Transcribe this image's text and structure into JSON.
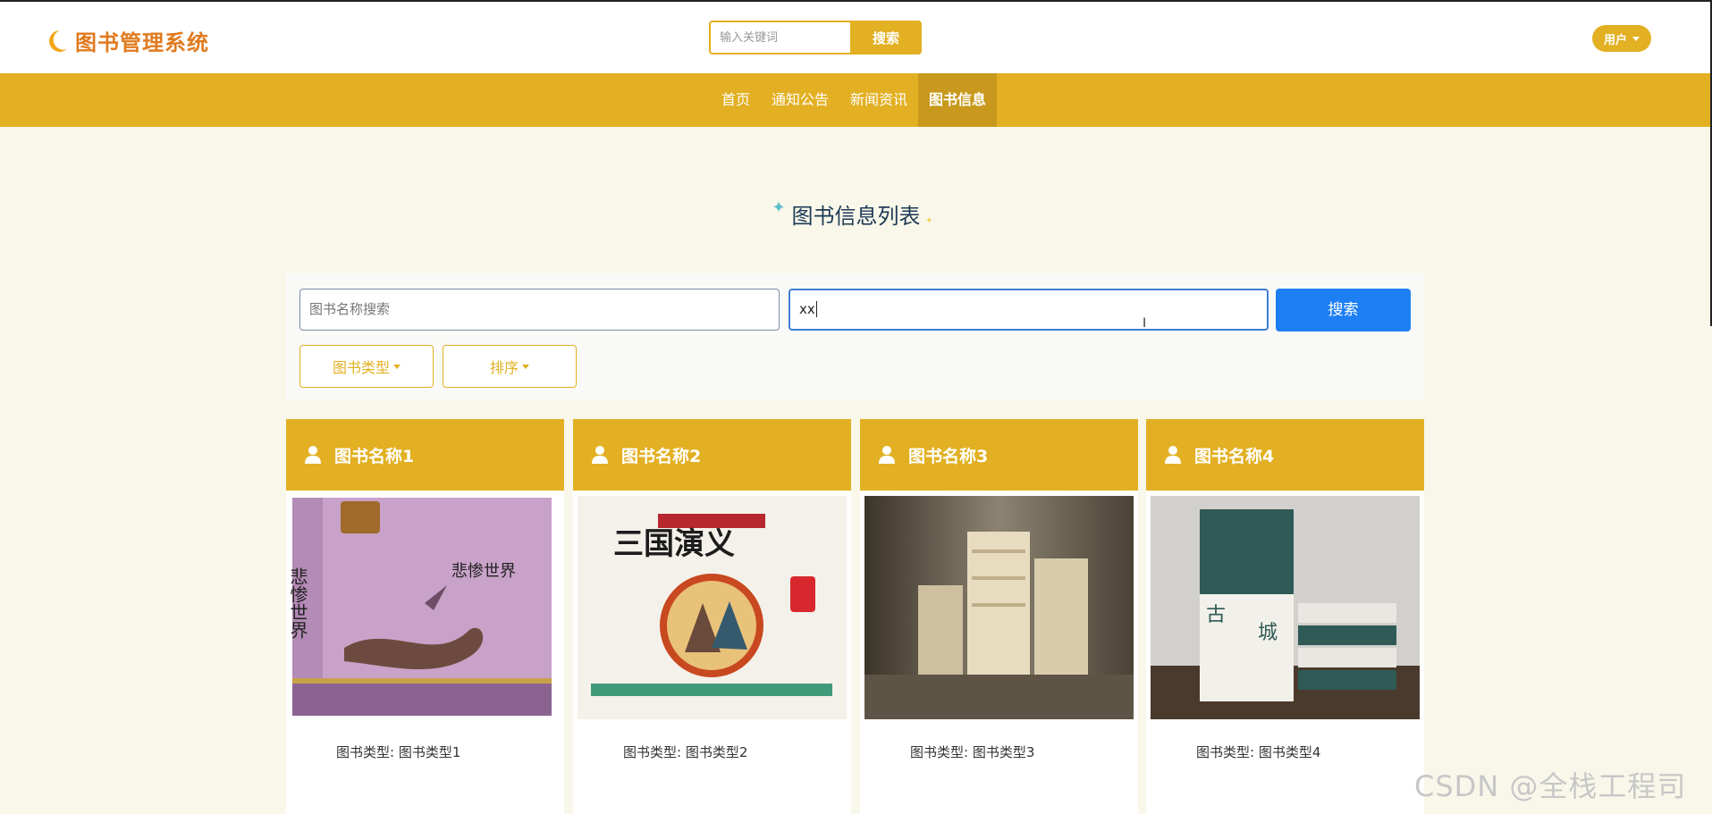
{
  "brand": {
    "title": "图书管理系统",
    "accent": "#e07a1f"
  },
  "top_search": {
    "placeholder": "输入关键词",
    "button": "搜索"
  },
  "user_menu": {
    "label": "用户"
  },
  "nav": {
    "items": [
      {
        "label": "首页",
        "active": false
      },
      {
        "label": "通知公告",
        "active": false
      },
      {
        "label": "新闻资讯",
        "active": false
      },
      {
        "label": "图书信息",
        "active": true
      }
    ]
  },
  "section": {
    "title": "图书信息列表"
  },
  "filters": {
    "name_placeholder": "图书名称搜索",
    "second_value": "xx",
    "search_button": "搜索",
    "type_dropdown": "图书类型",
    "sort_dropdown": "排序"
  },
  "cards": [
    {
      "name": "图书名称1",
      "type_label": "图书类型: 图书类型1",
      "image": "book-cover-les-miserables"
    },
    {
      "name": "图书名称2",
      "type_label": "图书类型: 图书类型2",
      "image": "book-cover-sanguo-yanyi"
    },
    {
      "name": "图书名称3",
      "type_label": "图书类型: 图书类型3",
      "image": "stacked-books-photo"
    },
    {
      "name": "图书名称4",
      "type_label": "图书类型: 图书类型4",
      "image": "book-set-photo"
    }
  ],
  "watermark": "CSDN @全栈工程司",
  "colors": {
    "theme": "#e2b022",
    "primary_button": "#1e7ff5",
    "background": "#f8f7ea"
  }
}
